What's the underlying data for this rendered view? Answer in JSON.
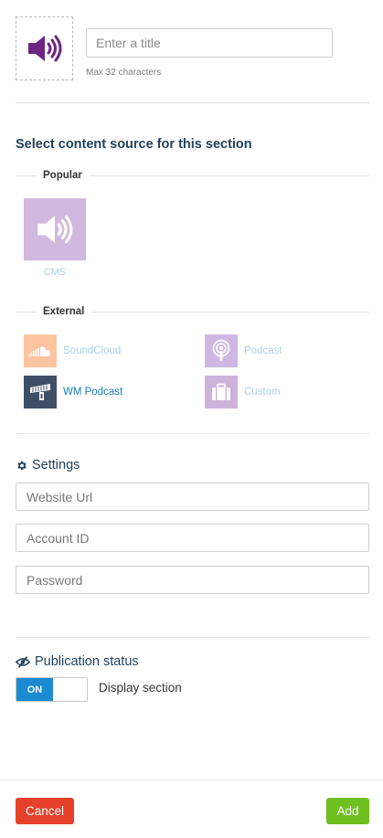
{
  "title_section": {
    "icon": "speaker-icon",
    "title_placeholder": "Enter a title",
    "title_value": "",
    "hint": "Max 32 characters"
  },
  "source": {
    "heading": "Select content source for this section",
    "popular": {
      "label": "Popular",
      "items": [
        {
          "label": "CMS",
          "icon": "speaker-icon",
          "color": "#d1b8de"
        }
      ]
    },
    "external": {
      "label": "External",
      "items": [
        {
          "label": "SoundCloud",
          "icon": "soundcloud-icon",
          "color": "#fcc49f"
        },
        {
          "label": "Podcast",
          "icon": "podcast-icon",
          "color": "#cfb7e3"
        },
        {
          "label": "WM Podcast",
          "icon": "wm-podcast-icon",
          "color": "#3d4e66",
          "selected": true
        },
        {
          "label": "Custom",
          "icon": "briefcase-icon",
          "color": "#cdb2dc"
        }
      ]
    }
  },
  "settings": {
    "heading": "Settings",
    "icon": "gear-icon",
    "fields": [
      {
        "placeholder": "Website Url",
        "value": ""
      },
      {
        "placeholder": "Account ID",
        "value": ""
      },
      {
        "placeholder": "Password",
        "value": ""
      }
    ]
  },
  "publication": {
    "heading": "Publication status",
    "icon": "eye-slash-icon",
    "toggle_label": "ON",
    "toggle_on": true,
    "display_label": "Display section"
  },
  "footer": {
    "cancel_label": "Cancel",
    "add_label": "Add"
  },
  "colors": {
    "accent": "#1a8ad1",
    "heading": "#1e3f5a",
    "cancel": "#e5402a",
    "add": "#6fbf1f",
    "title_icon": "#6b2482"
  }
}
